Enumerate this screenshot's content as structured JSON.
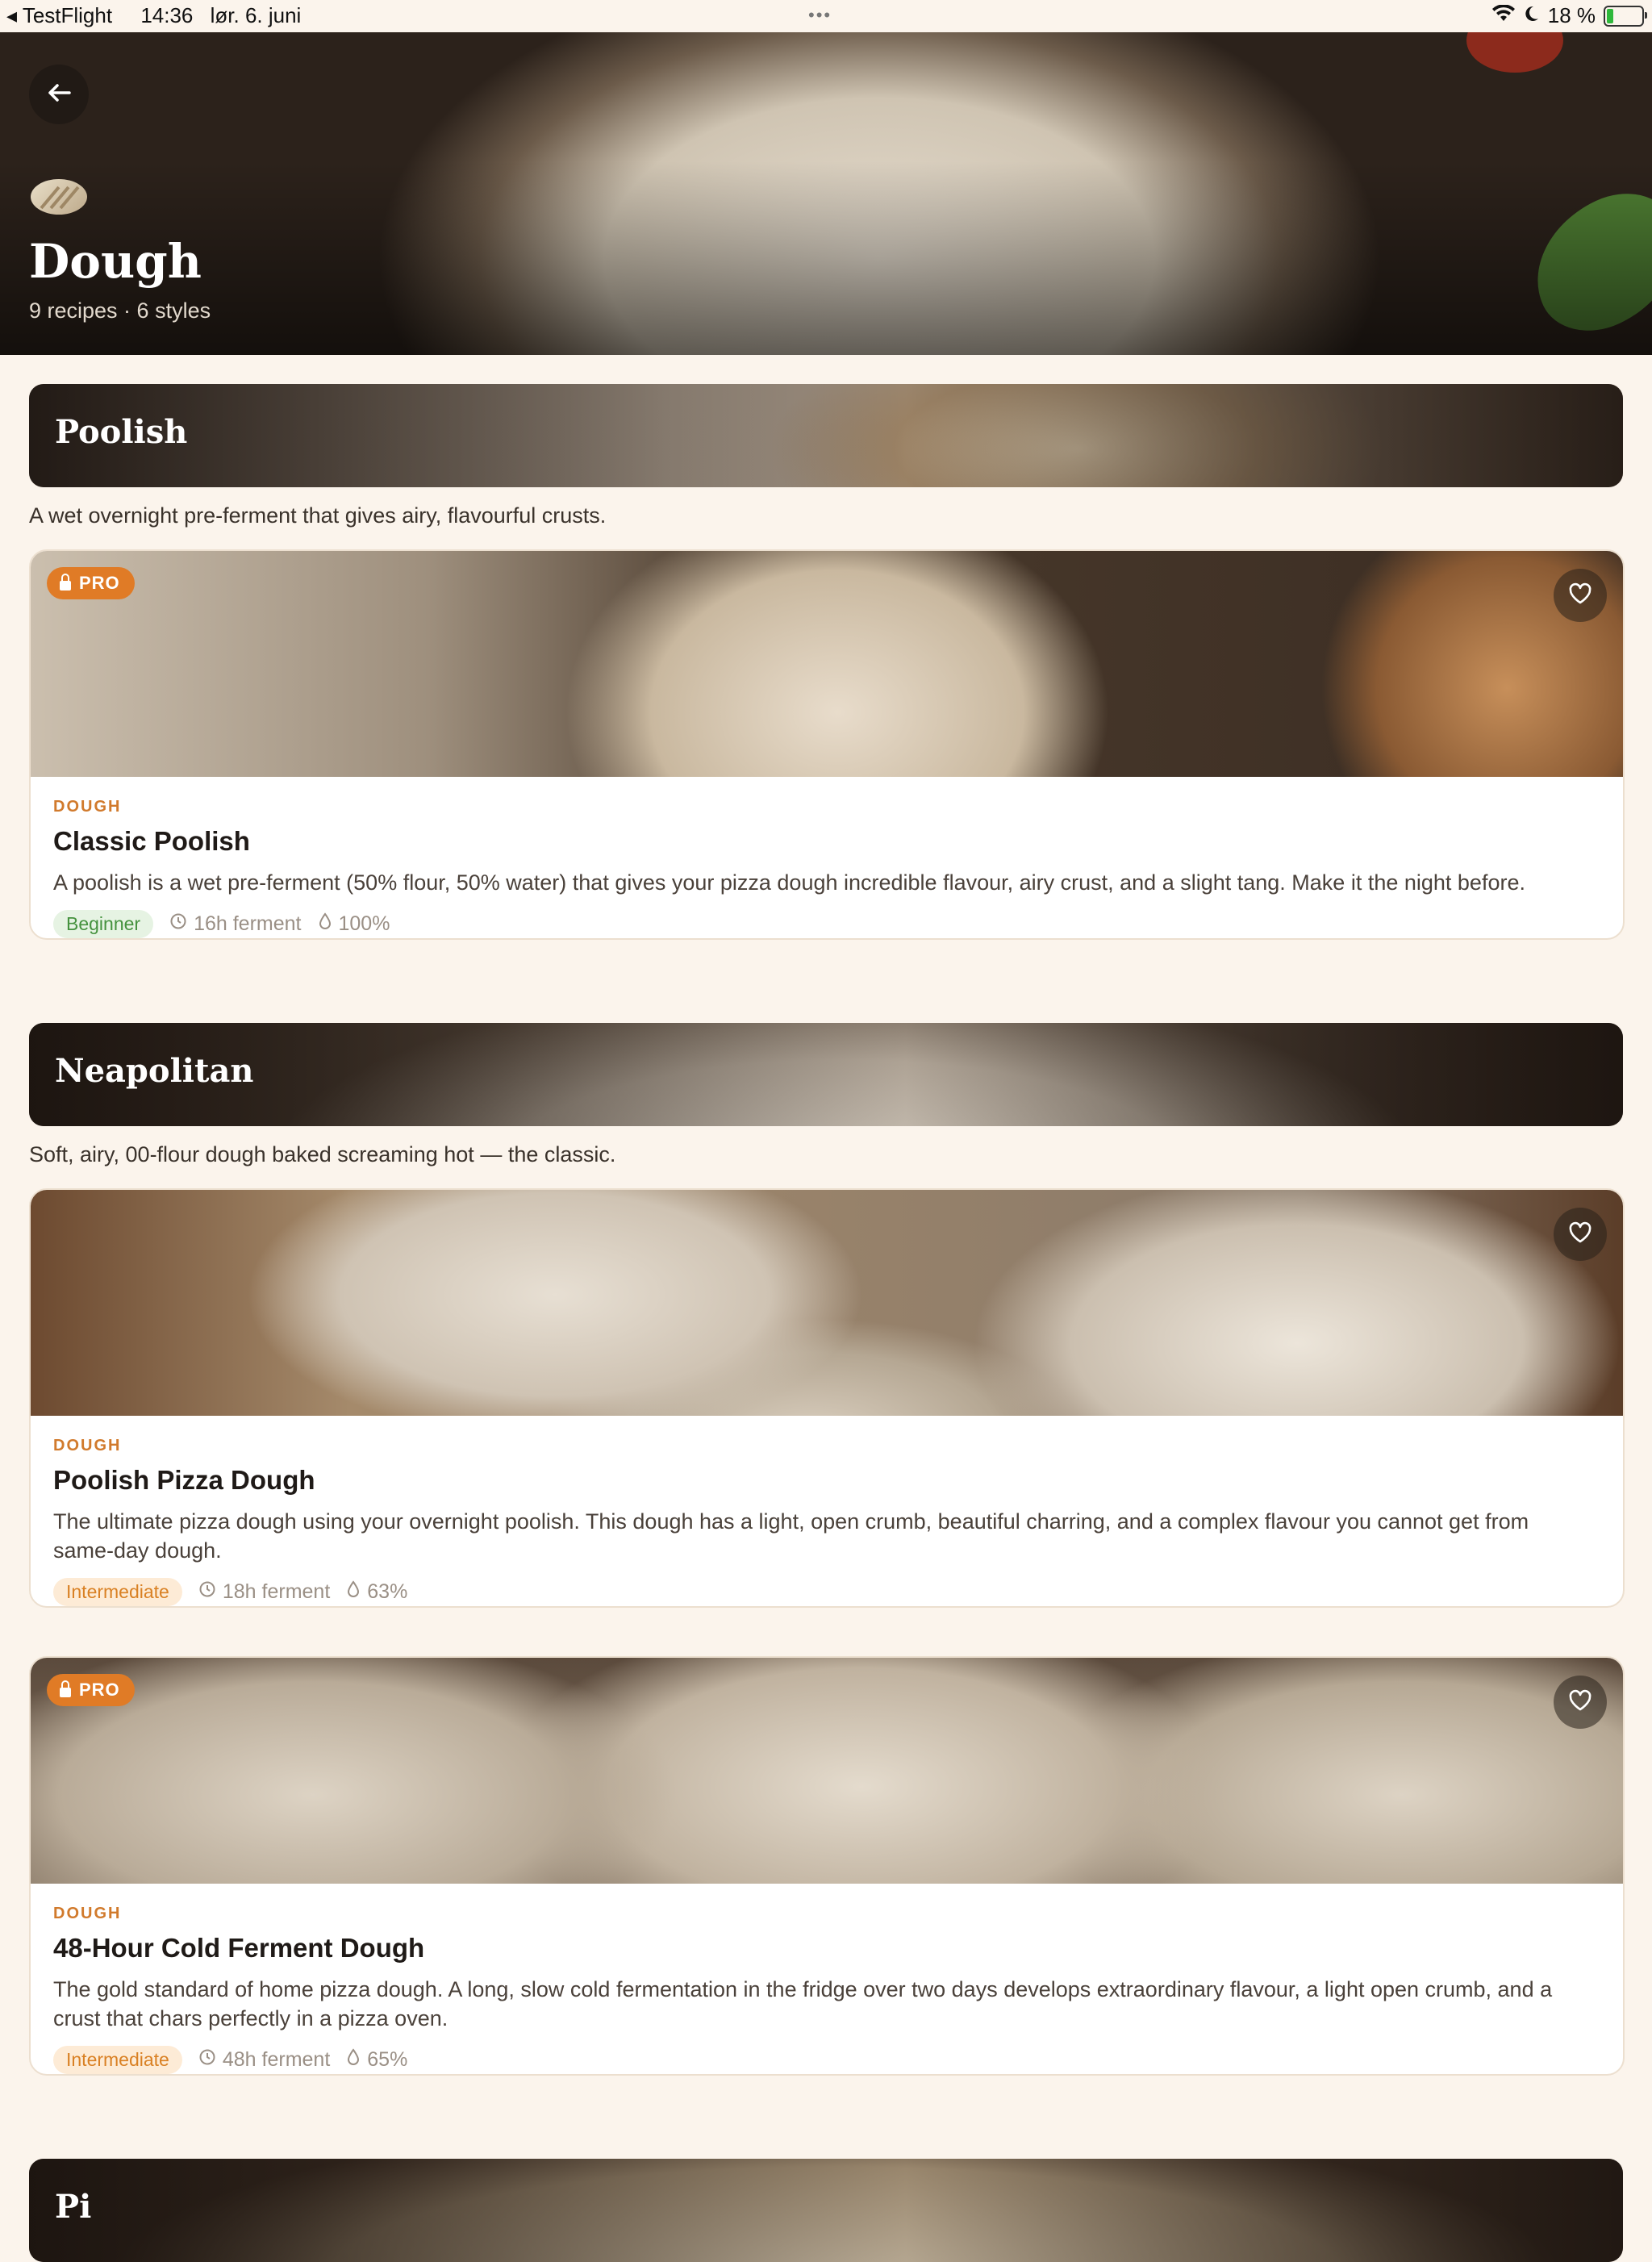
{
  "status_bar": {
    "app": "TestFlight",
    "time": "14:36",
    "date": "lør. 6. juni",
    "battery": "18 %",
    "battery_level": 0.18
  },
  "hero": {
    "title": "Dough",
    "subtitle": "9 recipes · 6 styles",
    "back_icon": "arrow-left-icon",
    "category_icon": "dough-icon"
  },
  "sections": [
    {
      "title": "Poolish",
      "description": "A wet overnight pre-ferment that gives airy, flavourful crusts.",
      "recipes": [
        {
          "category": "DOUGH",
          "title": "Classic Poolish",
          "description": "A poolish is a wet pre-ferment (50% flour, 50% water) that gives your pizza dough incredible flavour, airy crust, and a slight tang. Make it the night before.",
          "level": "Beginner",
          "ferment": "16h ferment",
          "hydration": "100%",
          "pro": "PRO"
        }
      ]
    },
    {
      "title": "Neapolitan",
      "description": "Soft, airy, 00-flour dough baked screaming hot — the classic.",
      "recipes": [
        {
          "category": "DOUGH",
          "title": "Poolish Pizza Dough",
          "description": "The ultimate pizza dough using your overnight poolish. This dough has a light, open crumb, beautiful charring, and a complex flavour you cannot get from same-day dough.",
          "level": "Intermediate",
          "ferment": "18h ferment",
          "hydration": "63%"
        },
        {
          "category": "DOUGH",
          "title": "48-Hour Cold Ferment Dough",
          "description": "The gold standard of home pizza dough. A long, slow cold fermentation in the fridge over two days develops extraordinary flavour, a light open crumb, and a crust that chars perfectly in a pizza oven.",
          "level": "Intermediate",
          "ferment": "48h ferment",
          "hydration": "65%",
          "pro": "PRO"
        }
      ]
    },
    {
      "title": "Pi"
    }
  ],
  "colors": {
    "background": "#fbf4ec",
    "accent": "#e07b26",
    "beginner": "#45923e",
    "intermediate": "#d98023"
  }
}
